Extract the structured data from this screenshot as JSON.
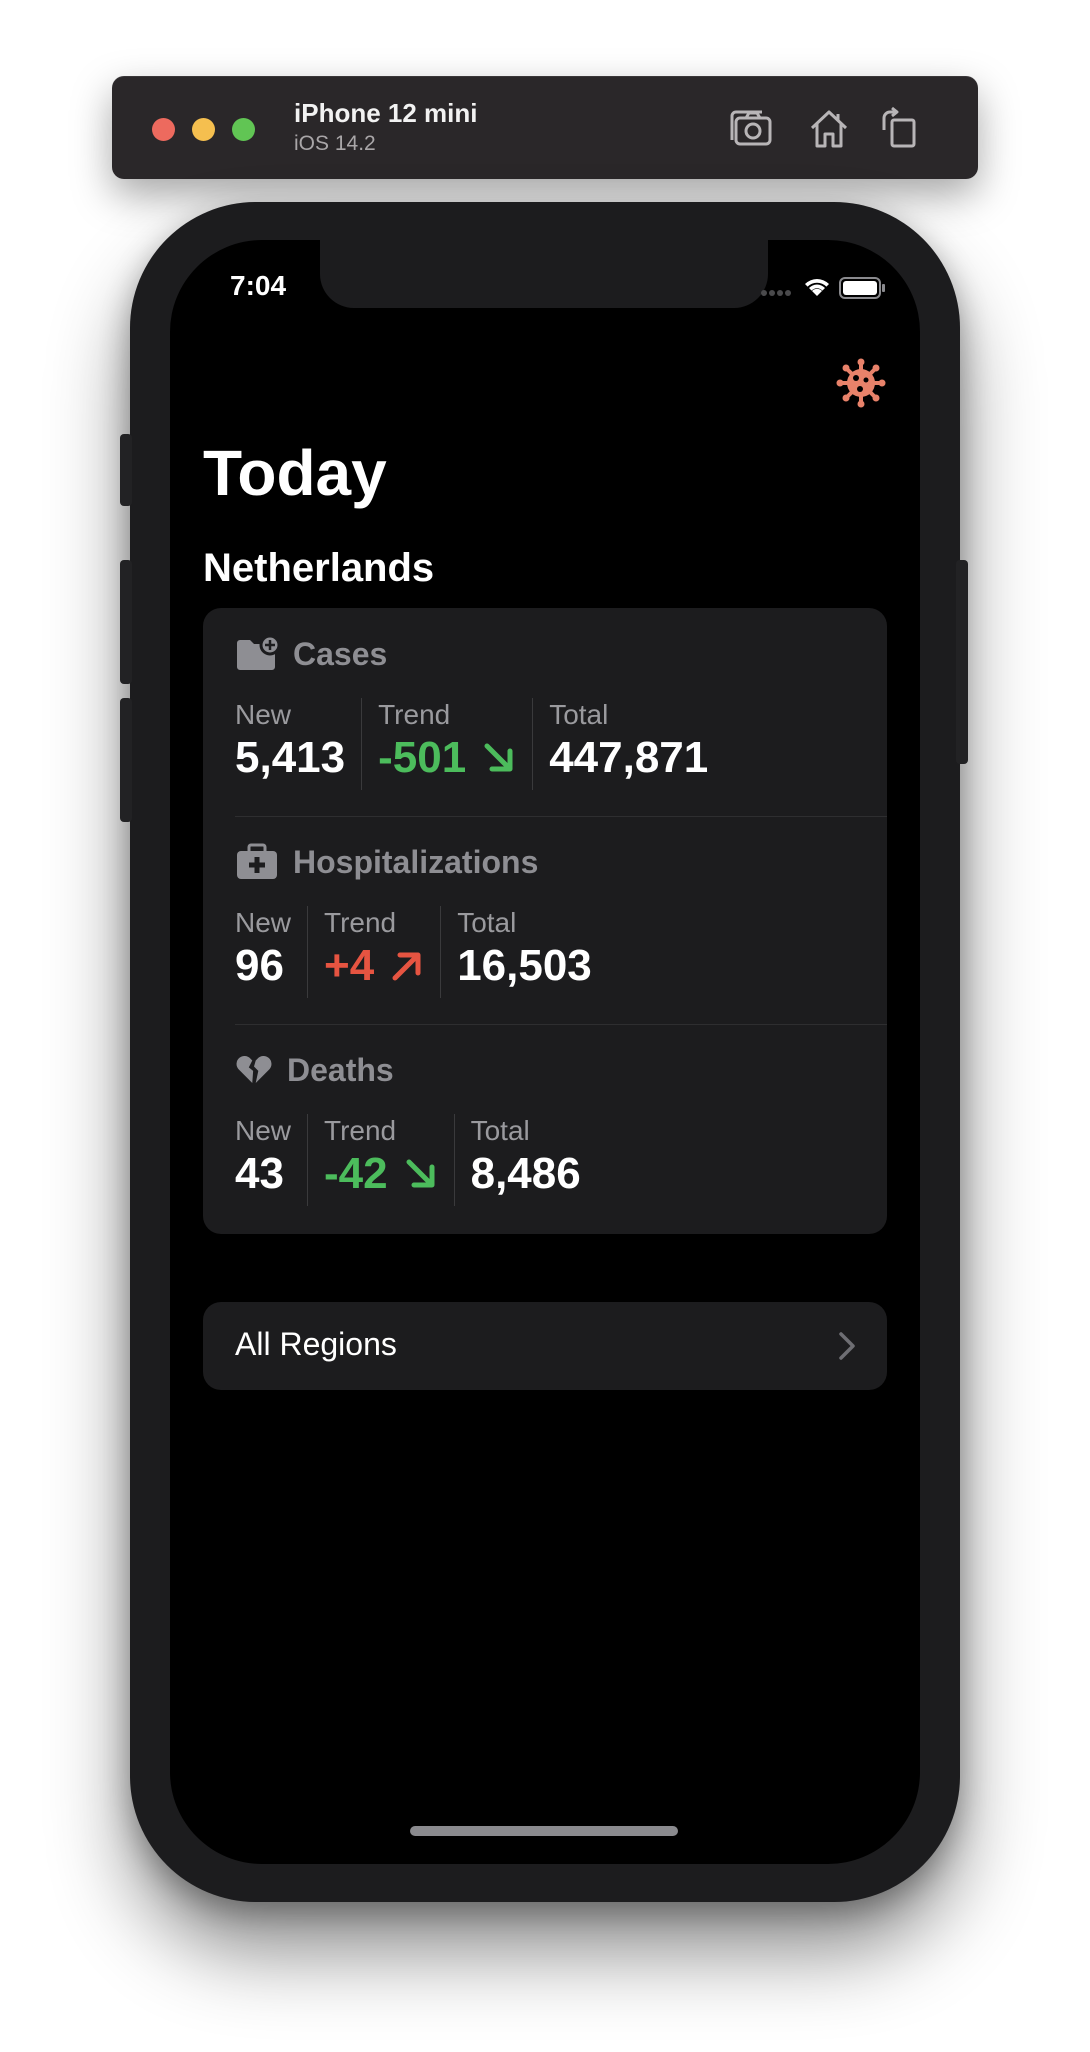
{
  "simulator": {
    "device_name": "iPhone 12 mini",
    "os_version": "iOS 14.2",
    "icons": [
      "screenshot-icon",
      "home-icon",
      "rotate-icon"
    ]
  },
  "status_bar": {
    "time": "7:04",
    "icons": [
      "signal-icon",
      "wifi-icon",
      "battery-icon"
    ]
  },
  "header": {
    "icon": "virus-icon",
    "title": "Today"
  },
  "region": "Netherlands",
  "colors": {
    "accent": "#e8826a",
    "trend_down": "#4cbc5c",
    "trend_up": "#e65441",
    "card_bg": "#1c1c1e",
    "label": "#8e8e93"
  },
  "stats": {
    "cases": {
      "icon": "folder-plus-icon",
      "title": "Cases",
      "new_label": "New",
      "new_value": "5,413",
      "trend_label": "Trend",
      "trend_value": "-501",
      "trend_direction": "down",
      "total_label": "Total",
      "total_value": "447,871"
    },
    "hospitalizations": {
      "icon": "medical-bag-icon",
      "title": "Hospitalizations",
      "new_label": "New",
      "new_value": "96",
      "trend_label": "Trend",
      "trend_value": "+4",
      "trend_direction": "up",
      "total_label": "Total",
      "total_value": "16,503"
    },
    "deaths": {
      "icon": "broken-heart-icon",
      "title": "Deaths",
      "new_label": "New",
      "new_value": "43",
      "trend_label": "Trend",
      "trend_value": "-42",
      "trend_direction": "down",
      "total_label": "Total",
      "total_value": "8,486"
    }
  },
  "all_regions": {
    "label": "All Regions",
    "icon": "chevron-right-icon"
  }
}
